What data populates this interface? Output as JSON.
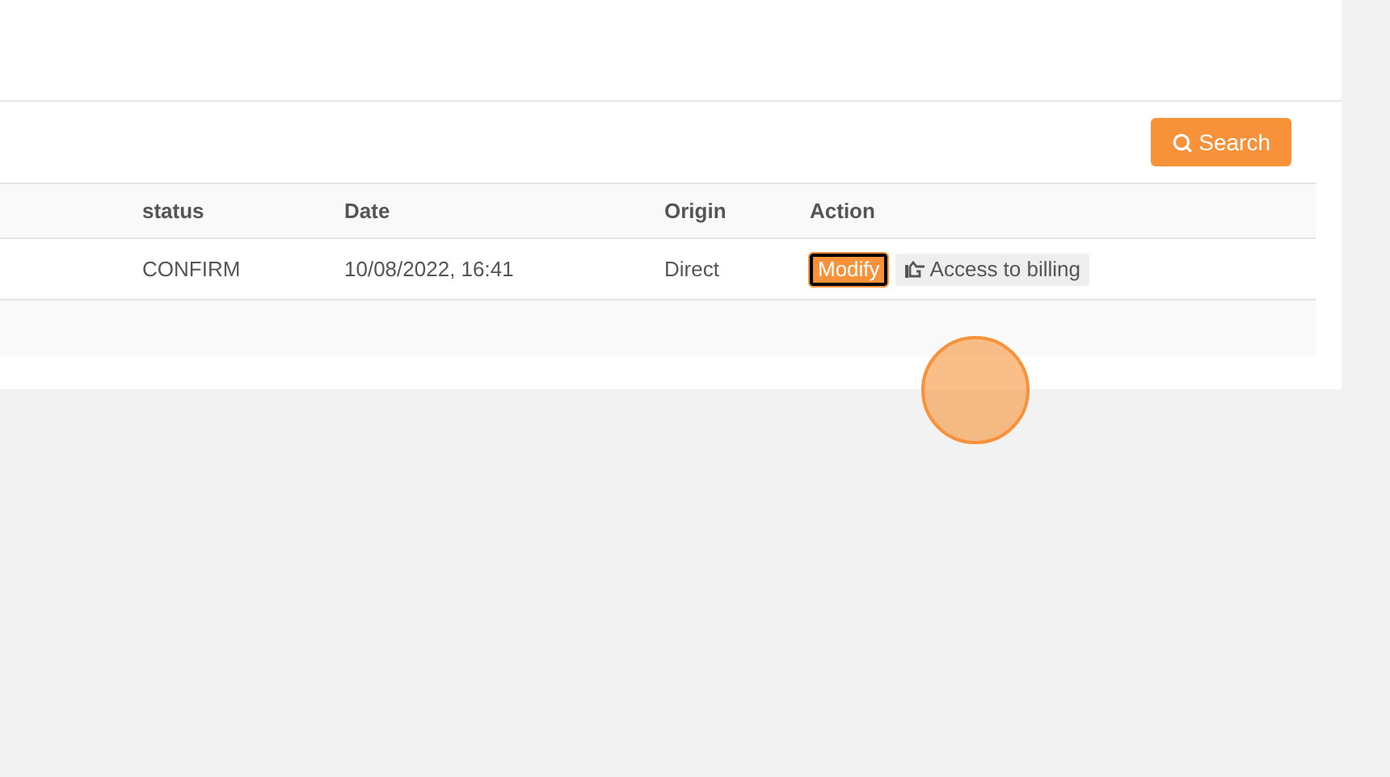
{
  "search_button": {
    "label": "Search"
  },
  "table": {
    "columns": [
      "status",
      "Date",
      "Origin",
      "Action"
    ],
    "rows": [
      {
        "status": "CONFIRM",
        "date": "10/08/2022, 16:41",
        "origin": "Direct",
        "actions": [
          {
            "kind": "primary",
            "label": "Modify"
          },
          {
            "kind": "secondary",
            "label": "Access to billing"
          }
        ]
      }
    ]
  }
}
